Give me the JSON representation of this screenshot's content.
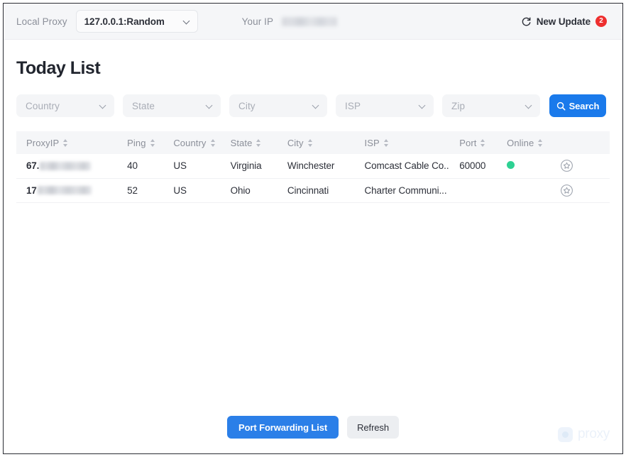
{
  "topbar": {
    "local_proxy_label": "Local Proxy",
    "local_proxy_value": "127.0.0.1:Random",
    "your_ip_label": "Your IP",
    "your_ip_value": "",
    "new_update_label": "New Update",
    "update_badge_count": "2",
    "refresh_icon": "refresh-icon",
    "chevron_icon": "chevron-down-icon"
  },
  "page": {
    "title": "Today List"
  },
  "filters": [
    {
      "name": "country",
      "placeholder": "Country"
    },
    {
      "name": "state",
      "placeholder": "State"
    },
    {
      "name": "city",
      "placeholder": "City"
    },
    {
      "name": "isp",
      "placeholder": "ISP"
    },
    {
      "name": "zip",
      "placeholder": "Zip"
    }
  ],
  "search": {
    "label": "Search",
    "icon": "search-icon",
    "color": "#1a7aeb"
  },
  "table": {
    "columns": [
      {
        "key": "proxyip",
        "label": "ProxyIP",
        "sortable": true
      },
      {
        "key": "ping",
        "label": "Ping",
        "sortable": true
      },
      {
        "key": "country",
        "label": "Country",
        "sortable": true
      },
      {
        "key": "state",
        "label": "State",
        "sortable": true
      },
      {
        "key": "city",
        "label": "City",
        "sortable": true
      },
      {
        "key": "isp",
        "label": "ISP",
        "sortable": true
      },
      {
        "key": "port",
        "label": "Port",
        "sortable": true
      },
      {
        "key": "online",
        "label": "Online",
        "sortable": true
      },
      {
        "key": "action",
        "label": "",
        "sortable": false
      }
    ],
    "rows": [
      {
        "proxyip_prefix": "67.",
        "proxyip_redacted": true,
        "ping": "40",
        "country": "US",
        "state": "Virginia",
        "city": "Winchester",
        "isp": "Comcast Cable Co...",
        "port": "60000",
        "online": true,
        "action_icon": "star-circle-icon"
      },
      {
        "proxyip_prefix": "17",
        "proxyip_redacted": true,
        "ping": "52",
        "country": "US",
        "state": "Ohio",
        "city": "Cincinnati",
        "isp": "Charter Communi...",
        "port": "",
        "online": false,
        "action_icon": "star-circle-icon"
      }
    ]
  },
  "footer": {
    "port_forwarding_label": "Port Forwarding List",
    "refresh_label": "Refresh",
    "watermark_text": "proxy",
    "watermark_icon": "proxy-logo-icon"
  },
  "colors": {
    "accent": "#1a7aeb",
    "badge": "#ee2f2f",
    "online": "#2ed193",
    "header_bg": "#f5f6f8"
  }
}
